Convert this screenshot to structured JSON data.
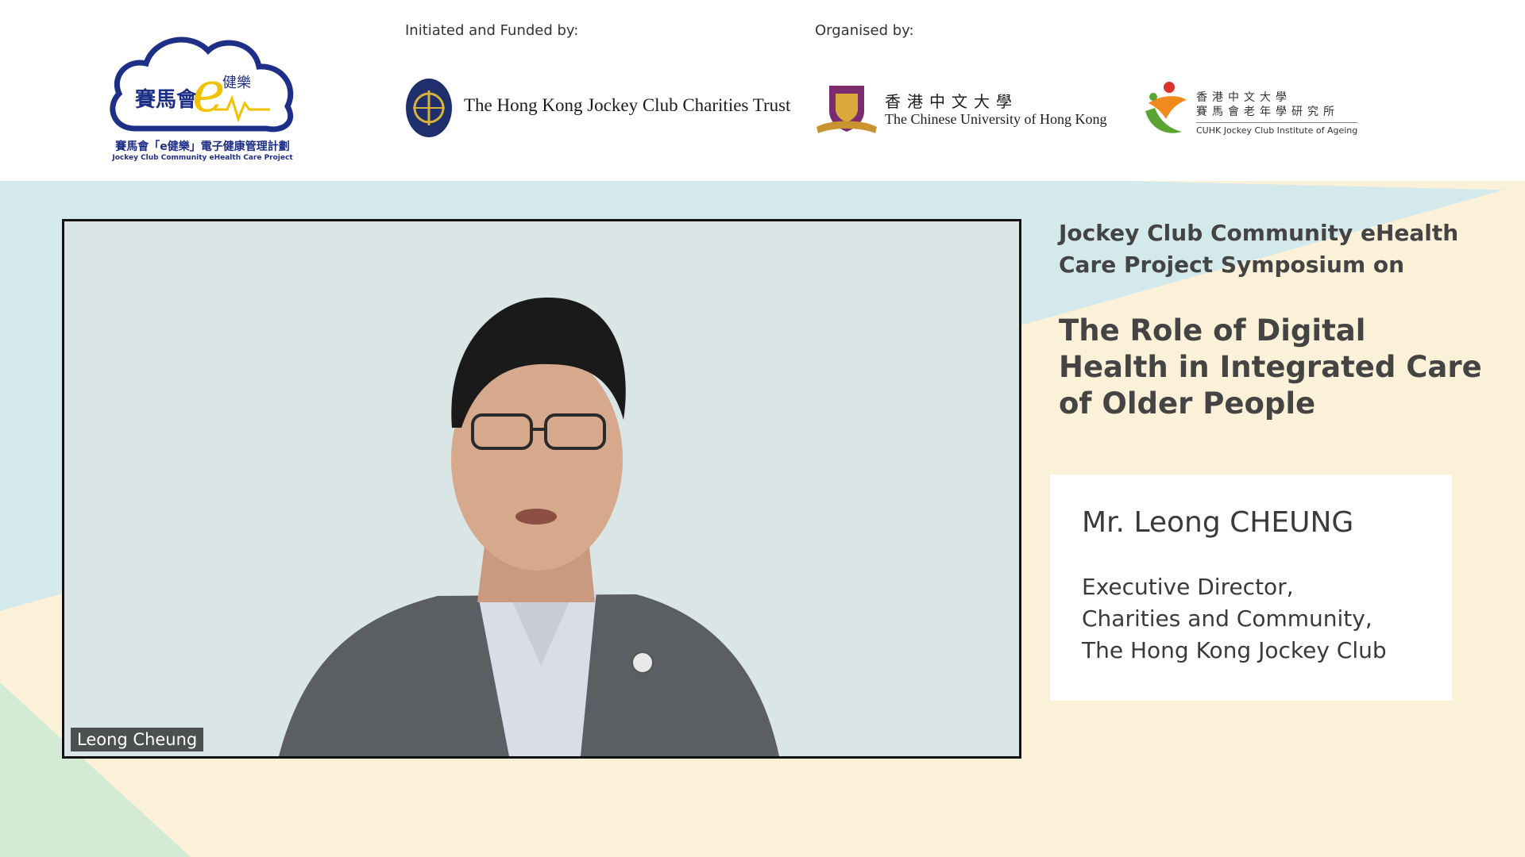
{
  "header": {
    "funded_caption": "Initiated and Funded by:",
    "organised_caption": "Organised by:",
    "project_logo": {
      "title_zh": "賽馬會「e健樂」電子健康管理計劃",
      "title_en": "Jockey Club Community eHealth Care Project",
      "mark_zh_left": "賽馬會",
      "mark_letter": "e",
      "mark_zh_right": "健樂"
    },
    "funder": {
      "name": "The Hong Kong Jockey Club Charities Trust"
    },
    "organiser_1": {
      "name_zh": "香港中文大學",
      "name_en": "The Chinese University of Hong Kong"
    },
    "organiser_2": {
      "name_zh_1": "香港中文大學",
      "name_zh_2": "賽馬會老年學研究所",
      "name_en": "CUHK Jockey Club Institute of Ageing"
    }
  },
  "video": {
    "participant_name": "Leong Cheung"
  },
  "symposium": {
    "intro_lines": [
      "Jockey Club Community eHealth",
      "Care Project Symposium on"
    ],
    "title_lines": [
      "The Role of Digital",
      "Health in Integrated Care",
      "of Older People"
    ]
  },
  "speaker": {
    "name": "Mr. Leong CHEUNG",
    "role_lines": [
      "Executive Director,",
      "Charities and Community,",
      "The Hong Kong Jockey Club"
    ]
  },
  "colors": {
    "header_bg": "#ffffff",
    "band_blue": "#d4e9ec",
    "band_cream": "#fbf1d8",
    "band_green": "#d3ead5",
    "logo_blue": "#1d2f86",
    "logo_yellow": "#f2c200",
    "text_gray": "#444444"
  }
}
